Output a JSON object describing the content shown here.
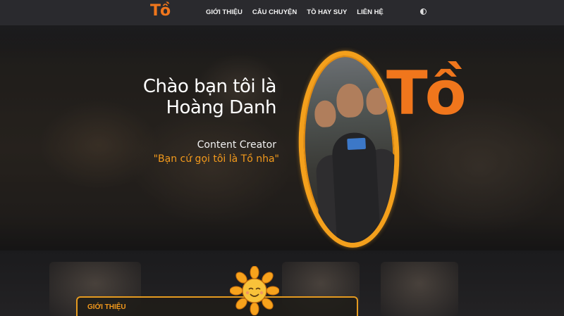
{
  "nav": {
    "logo": "Tồ",
    "links": [
      "GIỚI THIỆU",
      "CÂU CHUYỆN",
      "TỒ HAY SUY",
      "LIÊN HỆ"
    ],
    "theme_toggle_icon": "half-circle-icon"
  },
  "hero": {
    "greeting_line1": "Chào bạn tôi là",
    "greeting_line2": "Hoàng Danh",
    "job_title": "Content Creator",
    "quote": "\"Bạn cứ gọi tôi là Tồ nha\"",
    "big_logo": "Tồ"
  },
  "about": {
    "label": "GIỚI THIỆU"
  },
  "colors": {
    "accent": "#f0761c",
    "frame": "#f4a01c",
    "quote": "#f39a1c",
    "nav_bg": "#2a2a2e"
  }
}
